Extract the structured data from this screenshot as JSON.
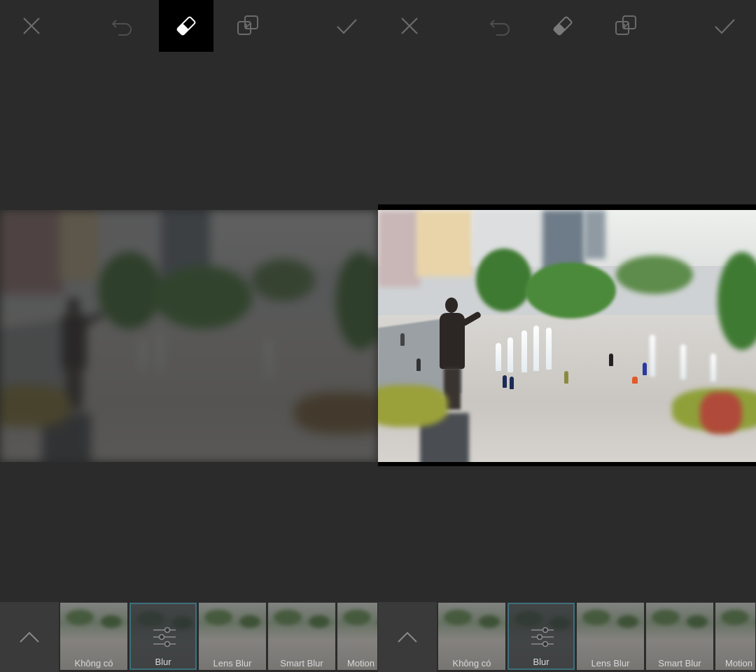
{
  "panels": [
    {
      "toolbar": {
        "close_icon": "close-icon",
        "undo_icon": "undo-icon",
        "eraser_icon": "eraser-icon",
        "compare_icon": "compare-icon",
        "confirm_icon": "checkmark-icon",
        "active_tool": "eraser"
      },
      "filters": [
        {
          "label": "Không có"
        },
        {
          "label": "Blur",
          "selected": true
        },
        {
          "label": "Lens Blur"
        },
        {
          "label": "Smart Blur"
        },
        {
          "label": "Motion"
        }
      ]
    },
    {
      "toolbar": {
        "close_icon": "close-icon",
        "undo_icon": "undo-icon",
        "eraser_icon": "eraser-icon",
        "compare_icon": "compare-icon",
        "confirm_icon": "checkmark-icon",
        "active_tool": "none"
      },
      "filters": [
        {
          "label": "Không có"
        },
        {
          "label": "Blur",
          "selected": true
        },
        {
          "label": "Lens Blur"
        },
        {
          "label": "Smart Blur"
        },
        {
          "label": "Motion"
        }
      ]
    }
  ],
  "colors": {
    "background": "#2b2b2b",
    "active_tool_bg": "#000000",
    "selected_thumb_border": "#3f6f7c",
    "icon_inactive": "#6b6b6b",
    "icon_active": "#ffffff"
  }
}
